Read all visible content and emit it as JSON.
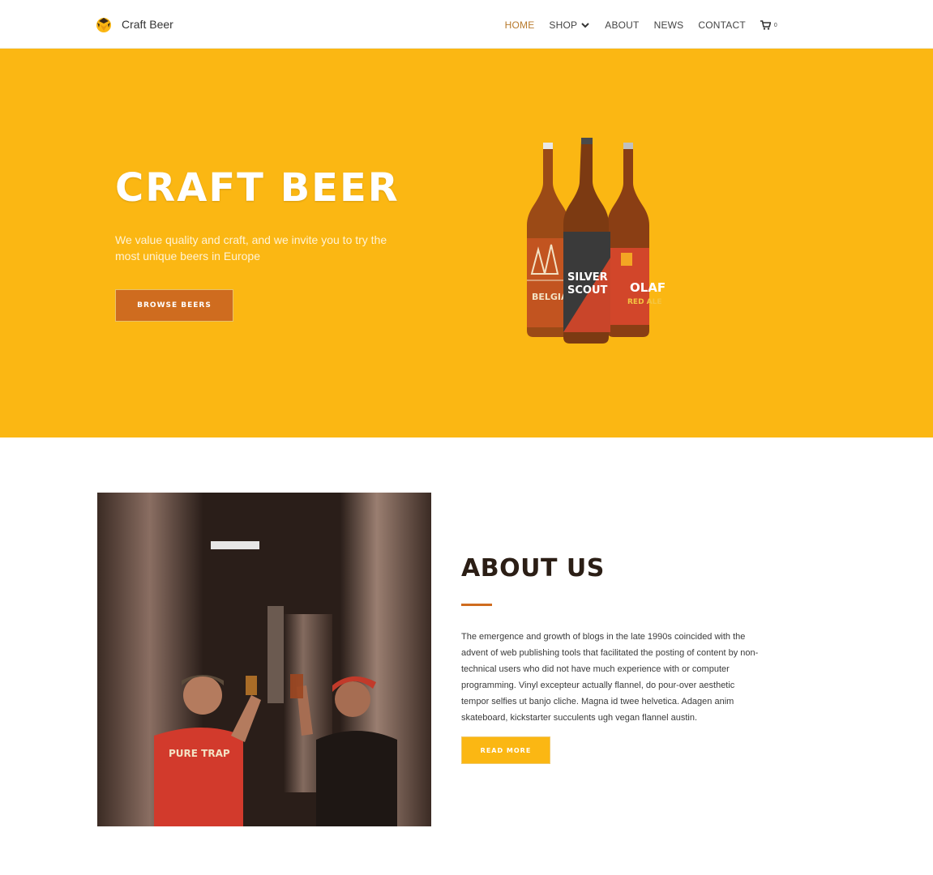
{
  "header": {
    "brand_name": "Craft Beer",
    "logo_icon": "hop-logo-icon",
    "nav": {
      "home": "HOME",
      "shop": "SHOP",
      "about": "ABOUT",
      "news": "NEWS",
      "contact": "CONTACT"
    },
    "cart_count": "0"
  },
  "hero": {
    "title": "CRAFT BEER",
    "subtitle": "We value quality and craft, and we invite you to try the most unique beers in Europe",
    "button_label": "BROWSE BEERS",
    "bottle_labels": {
      "left": "BELGIAN",
      "middle_line1": "SILVER",
      "middle_line2": "SCOUT",
      "right_line1": "OLAF",
      "right_line2": "RED ALE"
    }
  },
  "about": {
    "title": "ABOUT US",
    "body": "The emergence and growth of blogs in the late 1990s coincided with the advent of web publishing tools that facilitated the posting of content by non-technical users who did not have much experience with or computer programming. Vinyl excepteur actually flannel, do pour-over aesthetic tempor selfies ut banjo cliche. Magna id twee helvetica. Adagen anim skateboard, kickstarter succulents ugh vegan flannel austin.",
    "button_label": "READ MORE",
    "shirt_text": "PURE TRAP"
  },
  "colors": {
    "accent_yellow": "#fbb713",
    "accent_orange": "#cf6c1f",
    "nav_active": "#b87a2d"
  }
}
